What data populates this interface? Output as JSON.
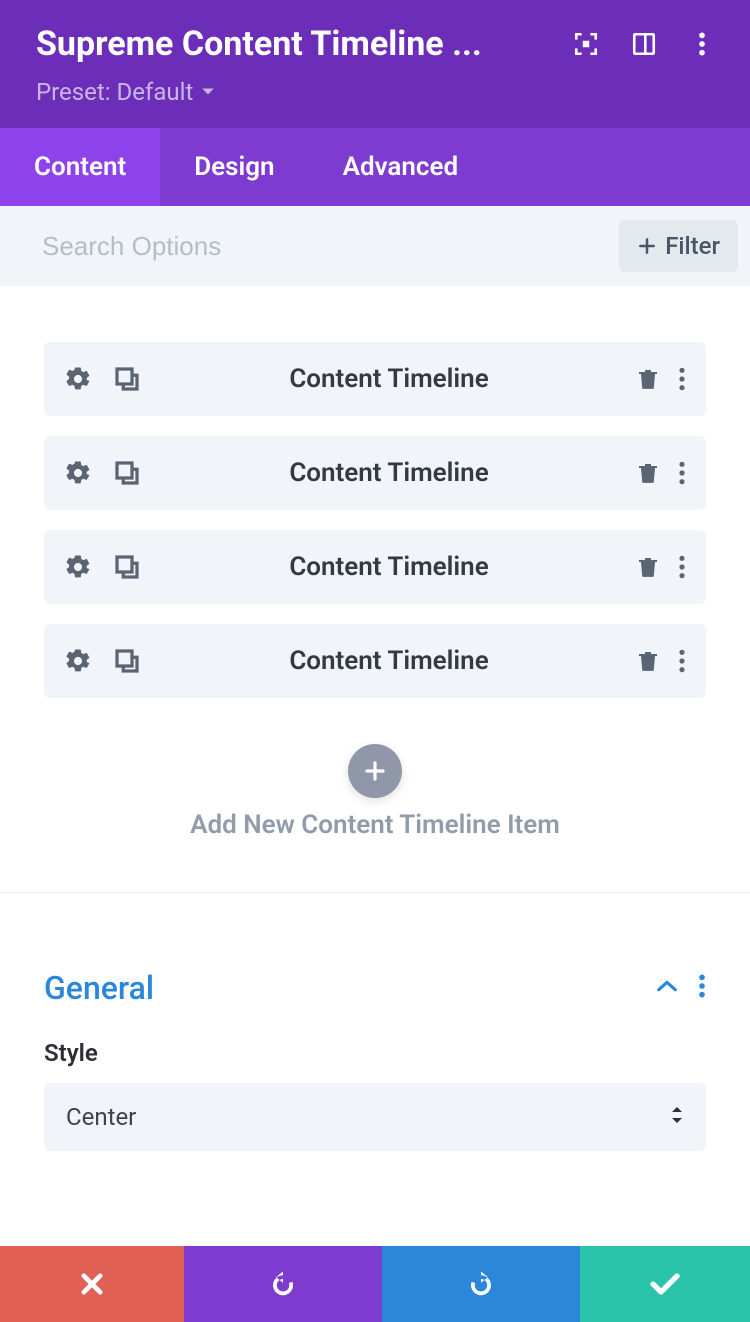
{
  "header": {
    "title": "Supreme Content Timeline ...",
    "preset_label": "Preset: Default"
  },
  "tabs": {
    "content": "Content",
    "design": "Design",
    "advanced": "Advanced"
  },
  "search": {
    "placeholder": "Search Options",
    "filter_label": "Filter"
  },
  "items": [
    {
      "label": "Content Timeline"
    },
    {
      "label": "Content Timeline"
    },
    {
      "label": "Content Timeline"
    },
    {
      "label": "Content Timeline"
    }
  ],
  "add": {
    "label": "Add New Content Timeline Item"
  },
  "general": {
    "title": "General",
    "style_label": "Style",
    "style_value": "Center"
  }
}
